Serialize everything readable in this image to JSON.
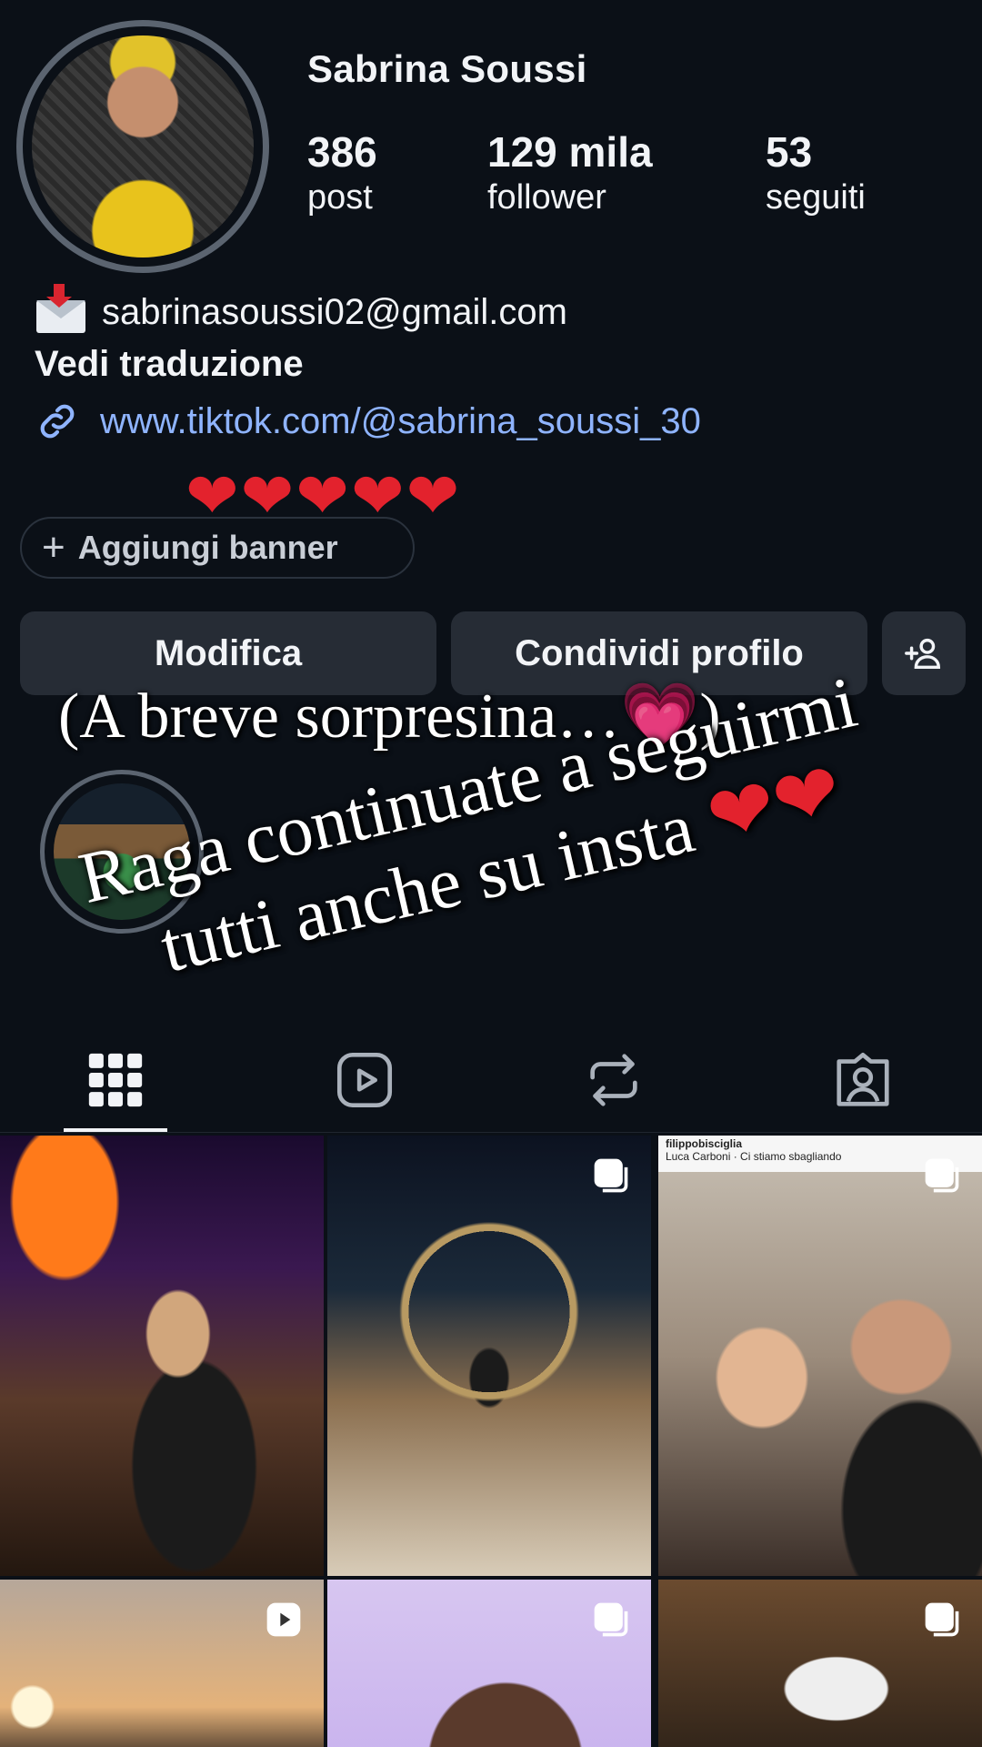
{
  "profile": {
    "username": "Sabrina Soussi",
    "stats": {
      "posts_count": "386",
      "posts_label": "post",
      "followers_count": "129 mila",
      "followers_label": "follower",
      "following_count": "53",
      "following_label": "seguiti"
    },
    "bio": {
      "email": "sabrinasoussi02@gmail.com",
      "translate": "Vedi traduzione",
      "link": "www.tiktok.com/@sabrina_soussi_30",
      "hearts": "❤❤❤❤❤"
    }
  },
  "add_banner_label": "Aggiungi banner",
  "buttons": {
    "edit": "Modifica",
    "share": "Condividi profilo"
  },
  "overlays": {
    "line1_text": "(A breve sorpresina…",
    "line1_heart": "💗",
    "line1_close": ")",
    "line2a": "Raga continuate a seguirmi",
    "line2b": "tutti anche su insta",
    "line2_hearts": "❤❤"
  },
  "post_header": {
    "account": "filippobisciglia",
    "song": "Luca Carboni · Ci stiamo sbagliando"
  },
  "colors": {
    "background": "#0b1017",
    "button": "#262c35",
    "link": "#8fb4ff",
    "heart": "#e3222d"
  },
  "icons": {
    "tabs": [
      "grid-icon",
      "reels-icon",
      "reposts-icon",
      "tagged-icon"
    ],
    "badges": [
      "carousel-icon",
      "carousel-icon",
      "carousel-icon",
      "play-icon",
      "carousel-icon",
      "carousel-icon"
    ]
  }
}
